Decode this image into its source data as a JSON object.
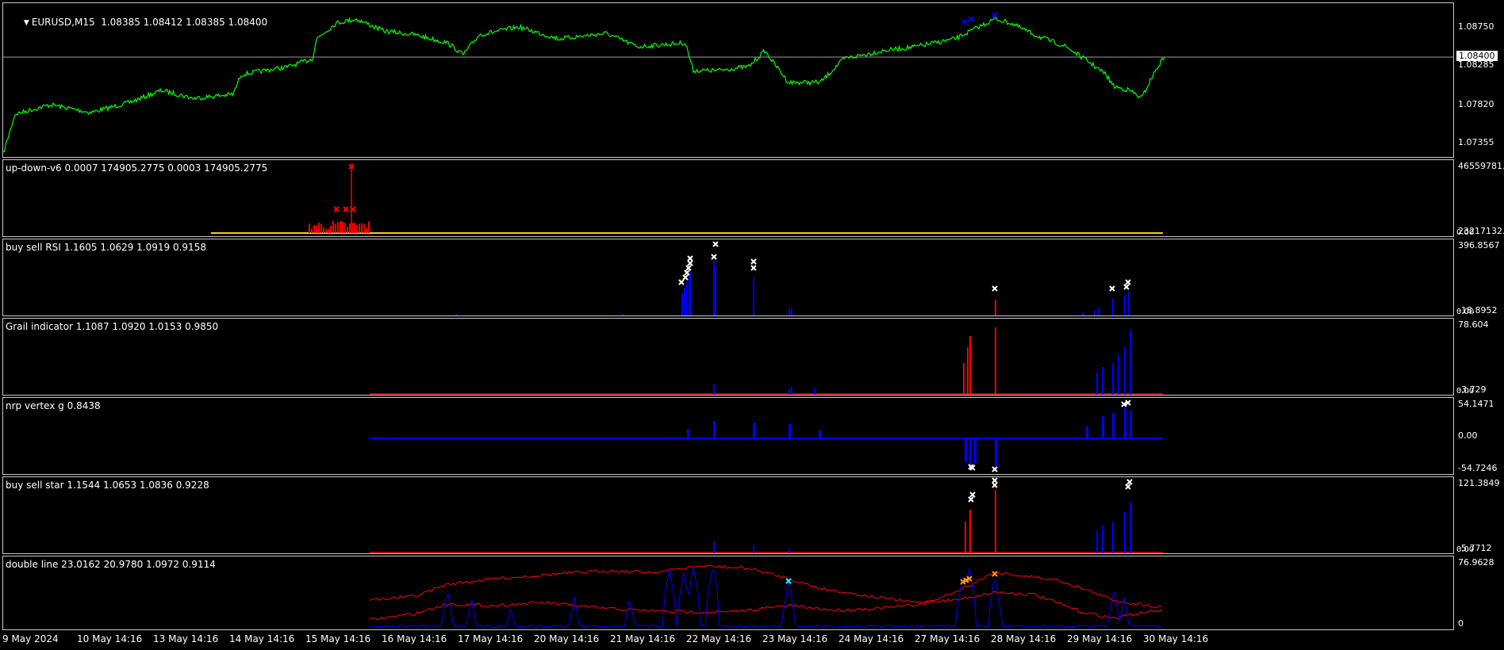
{
  "window": {
    "symbol_label": "EURUSD,M15  1.08385 1.08412 1.08385 1.08400",
    "current_price": "1.08400",
    "price_axis": [
      "1.08750",
      "1.08285",
      "1.07820",
      "1.07355"
    ]
  },
  "panes": [
    {
      "id": "up-down",
      "label": "up-down-v6 0.0007 174905.2775 0.0003 174905.2775",
      "axis": [
        "46559781.",
        "23217132.4",
        "0.00"
      ]
    },
    {
      "id": "buy-sell-rsi",
      "label": "buy sell RSI 1.1605 1.0629 1.0919 0.9158",
      "axis": [
        "396.8567",
        "-18.8952",
        "0.00"
      ]
    },
    {
      "id": "grail",
      "label": "Grail indicator 1.1087 1.0920 1.0153 0.9850",
      "axis": [
        "78.604",
        "-3.729",
        "0.00"
      ]
    },
    {
      "id": "nrp-vertex",
      "label": "nrp vertex g 0.8438",
      "axis": [
        "54.1471",
        "0.00",
        "-54.7246"
      ]
    },
    {
      "id": "buy-sell-star",
      "label": "buy sell star 1.1544 1.0653 1.0836 0.9228",
      "axis": [
        "121.3849",
        "-5.7712",
        "0.00"
      ]
    },
    {
      "id": "double-line",
      "label": "double line 23.0162 20.9780 1.0972 0.9114",
      "axis": [
        "76.9628",
        "0"
      ]
    }
  ],
  "time_axis": [
    "9 May 2024",
    "10 May 14:16",
    "13 May 14:16",
    "14 May 14:16",
    "15 May 14:16",
    "16 May 14:16",
    "17 May 14:16",
    "20 May 14:16",
    "21 May 14:16",
    "22 May 14:16",
    "23 May 14:16",
    "24 May 14:16",
    "27 May 14:16",
    "28 May 14:16",
    "29 May 14:16",
    "30 May 14:16"
  ],
  "colors": {
    "price_line": "#00ff00",
    "blue_series": "#0000ff",
    "red_series": "#ff0000",
    "gold_line": "#ffcc00",
    "orange_marker": "#ff9900",
    "cyan_marker": "#00ffff",
    "marker_white": "#ffffff",
    "pane_border": "#c8c8c8"
  }
}
